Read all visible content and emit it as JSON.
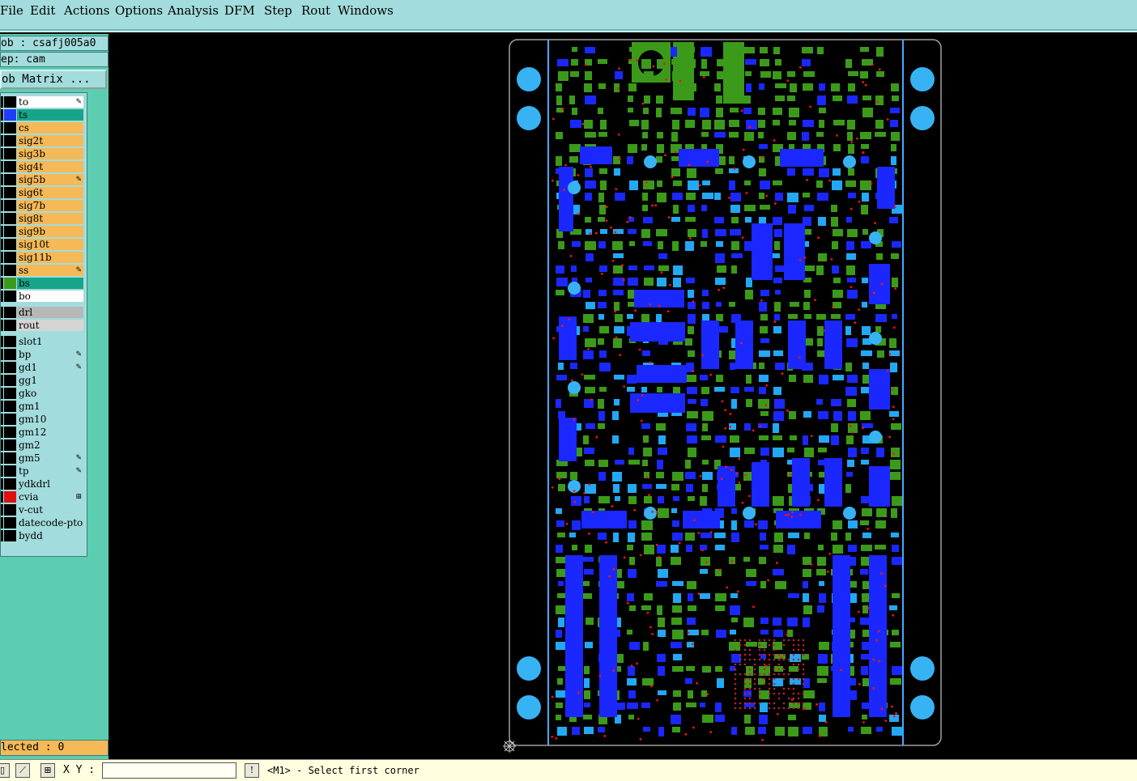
{
  "menu": {
    "file": "File",
    "edit": "Edit",
    "actions": "Actions",
    "options": "Options",
    "analysis": "Analysis",
    "dfm": "DFM",
    "step": "Step",
    "rout": "Rout",
    "windows": "Windows"
  },
  "job": {
    "job_line": "ob : csafj005a0",
    "step_line": "ep: cam"
  },
  "matrix_button": "ob Matrix ...",
  "layers": [
    {
      "name": "to",
      "color": "#ffffff",
      "swatch": "#000000",
      "flag": "pen"
    },
    {
      "name": "ts",
      "color": "#17a58a",
      "swatch": "#1f3cff",
      "flag": ""
    },
    {
      "name": "cs",
      "color": "#f5b957",
      "swatch": "#000000",
      "flag": ""
    },
    {
      "name": "sig2t",
      "color": "#f5b957",
      "swatch": "#000000",
      "flag": ""
    },
    {
      "name": "sig3b",
      "color": "#f5b957",
      "swatch": "#000000",
      "flag": ""
    },
    {
      "name": "sig4t",
      "color": "#f5b957",
      "swatch": "#000000",
      "flag": ""
    },
    {
      "name": "sig5b",
      "color": "#f5b957",
      "swatch": "#000000",
      "flag": "pen"
    },
    {
      "name": "sig6t",
      "color": "#f5b957",
      "swatch": "#000000",
      "flag": ""
    },
    {
      "name": "sig7b",
      "color": "#f5b957",
      "swatch": "#000000",
      "flag": ""
    },
    {
      "name": "sig8t",
      "color": "#f5b957",
      "swatch": "#000000",
      "flag": ""
    },
    {
      "name": "sig9b",
      "color": "#f5b957",
      "swatch": "#000000",
      "flag": ""
    },
    {
      "name": "sig10t",
      "color": "#f5b957",
      "swatch": "#000000",
      "flag": ""
    },
    {
      "name": "sig11b",
      "color": "#f5b957",
      "swatch": "#000000",
      "flag": ""
    },
    {
      "name": "ss",
      "color": "#f5b957",
      "swatch": "#000000",
      "flag": "pen"
    },
    {
      "name": "bs",
      "color": "#17a58a",
      "swatch": "#3c9a1a",
      "flag": ""
    },
    {
      "name": "bo",
      "color": "#ffffff",
      "swatch": "#000000",
      "flag": ""
    },
    {
      "name": "drl",
      "color": "#b7b7b7",
      "swatch": "#000000",
      "flag": ""
    },
    {
      "name": "rout",
      "color": "#d5d5d5",
      "swatch": "#000000",
      "flag": ""
    },
    {
      "name": "slot1",
      "color": "#a3dcdc",
      "swatch": "#000000",
      "flag": ""
    },
    {
      "name": "bp",
      "color": "#a3dcdc",
      "swatch": "#000000",
      "flag": "pen"
    },
    {
      "name": "gd1",
      "color": "#a3dcdc",
      "swatch": "#000000",
      "flag": "pen"
    },
    {
      "name": "gg1",
      "color": "#a3dcdc",
      "swatch": "#000000",
      "flag": ""
    },
    {
      "name": "gko",
      "color": "#a3dcdc",
      "swatch": "#000000",
      "flag": ""
    },
    {
      "name": "gm1",
      "color": "#a3dcdc",
      "swatch": "#000000",
      "flag": ""
    },
    {
      "name": "gm10",
      "color": "#a3dcdc",
      "swatch": "#000000",
      "flag": ""
    },
    {
      "name": "gm12",
      "color": "#a3dcdc",
      "swatch": "#000000",
      "flag": ""
    },
    {
      "name": "gm2",
      "color": "#a3dcdc",
      "swatch": "#000000",
      "flag": ""
    },
    {
      "name": "gm5",
      "color": "#a3dcdc",
      "swatch": "#000000",
      "flag": "pen"
    },
    {
      "name": "tp",
      "color": "#a3dcdc",
      "swatch": "#000000",
      "flag": "pen"
    },
    {
      "name": "ydkdrl",
      "color": "#a3dcdc",
      "swatch": "#000000",
      "flag": ""
    },
    {
      "name": "cvia",
      "color": "#a3dcdc",
      "swatch": "#e01010",
      "flag": "grid"
    },
    {
      "name": "v-cut",
      "color": "#a3dcdc",
      "swatch": "#000000",
      "flag": ""
    },
    {
      "name": "datecode-pto",
      "color": "#a3dcdc",
      "swatch": "#000000",
      "flag": ""
    },
    {
      "name": "bydd",
      "color": "#a3dcdc",
      "swatch": "#000000",
      "flag": ""
    }
  ],
  "selected": "lected : 0",
  "status": {
    "xy_label": "X Y :",
    "xy_value": "",
    "prompt": "<M1> - Select first corner",
    "icons": [
      "ruler-icon",
      "snap-icon",
      "grid-icon",
      "alert-icon"
    ]
  },
  "colors": {
    "menubar": "#a3dcdc",
    "panel": "#5ccdb0",
    "board_bg": "#000000",
    "pad_green": "#3c9a1a",
    "pad_blue": "#1a28ff",
    "pad_light_blue": "#23a8f5",
    "via_red": "#ff1010",
    "outline": "#a0a0a0"
  }
}
